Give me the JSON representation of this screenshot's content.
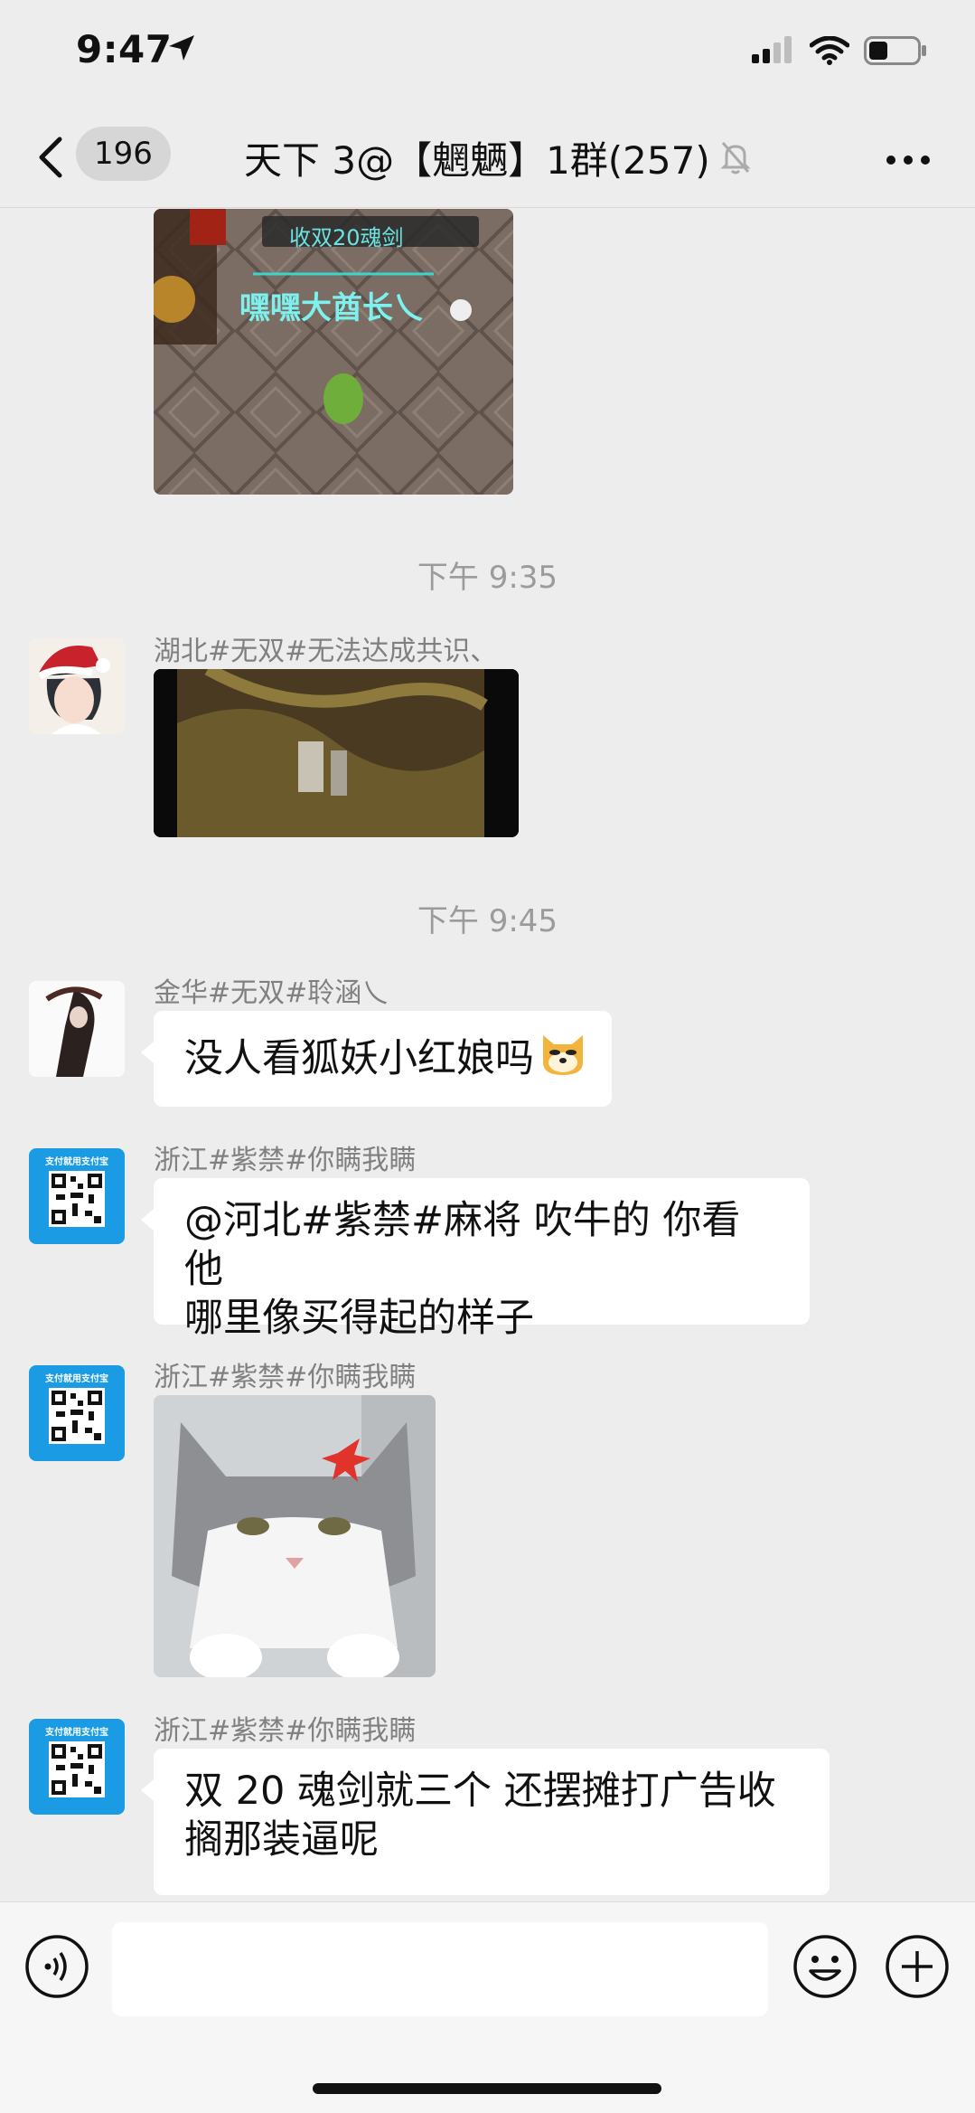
{
  "status_bar": {
    "time": "9:47"
  },
  "nav": {
    "unread_count": "196",
    "title": "天下 3@【魍魉】1群(257)"
  },
  "icons": {
    "back": "chevron-left-icon",
    "mute": "bell-slash-icon",
    "more": "more-icon",
    "voice": "voice-icon",
    "emoji": "emoji-icon",
    "plus": "plus-icon"
  },
  "messages": {
    "top_image_text_1": "收双20魂剑",
    "top_image_text_2": "嘿嘿大酋长乀",
    "ts1": "下午 9:35",
    "sender1": "湖北#无双#无法达成共识、",
    "ts2": "下午 9:45",
    "sender2": "金华#无双#聆涵乀",
    "text2": "没人看狐妖小红娘吗",
    "sender3": "浙江#紫禁#你瞒我瞒",
    "text3_line1": "@河北#紫禁#麻将 吹牛的 你看他",
    "text3_line2": "哪里像买得起的样子",
    "sender4": "浙江#紫禁#你瞒我瞒",
    "sender5": "浙江#紫禁#你瞒我瞒",
    "text5_line1": "双 20 魂剑就三个 还摆摊打广告收",
    "text5_line2": "搁那装逼呢",
    "qr_label": "支付就用支付宝"
  },
  "colors": {
    "background": "#ededed",
    "bubble": "#ffffff",
    "timestamp": "#9b9b9b",
    "sender": "#808080",
    "qr_avatar": "#1a9be3"
  }
}
